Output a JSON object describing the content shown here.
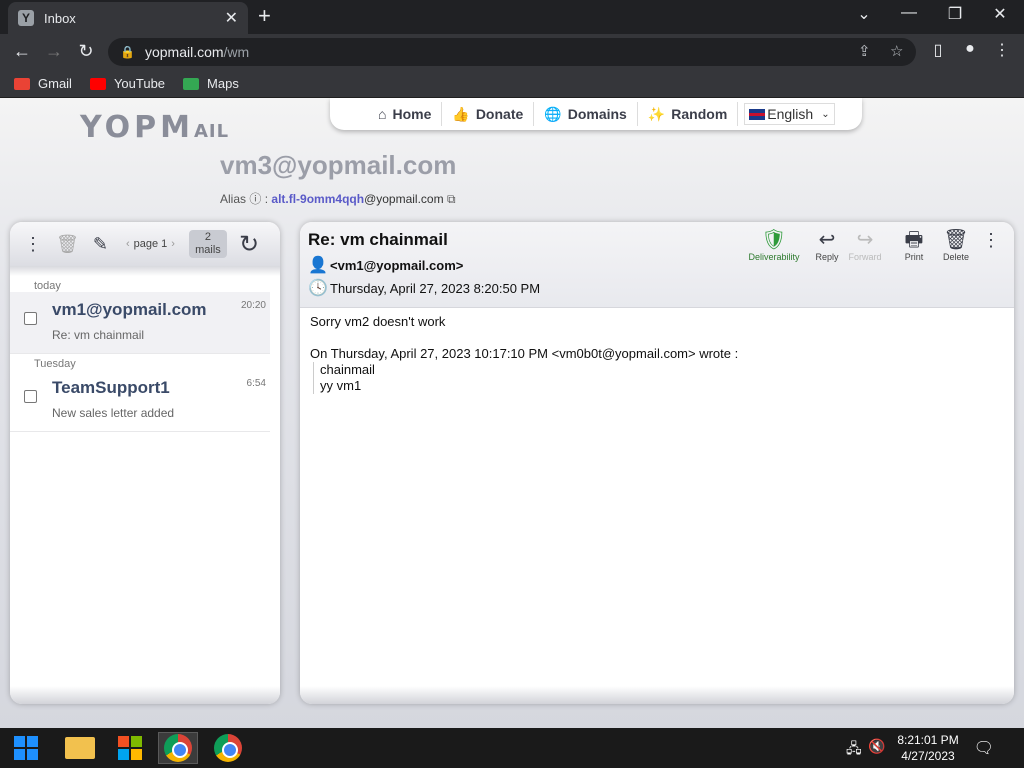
{
  "browser": {
    "tab_title": "Inbox",
    "tab_favicon": "Y",
    "url_host": "yopmail.com",
    "url_path": "/wm",
    "bookmarks": [
      {
        "label": "Gmail",
        "color": "#ea4335"
      },
      {
        "label": "YouTube",
        "color": "#ff0000"
      },
      {
        "label": "Maps",
        "color": "#34a853"
      }
    ]
  },
  "site": {
    "logo_main": "YOPM",
    "logo_tail": "AIL",
    "nav": [
      {
        "label": "Home",
        "icon": "home-icon",
        "glyph": "⌂"
      },
      {
        "label": "Donate",
        "icon": "thumbs-up-icon",
        "glyph": "👍"
      },
      {
        "label": "Domains",
        "icon": "globe-icon",
        "glyph": "🌐"
      },
      {
        "label": "Random",
        "icon": "magic-wand-icon",
        "glyph": "✨"
      }
    ],
    "language": "English",
    "mailbox": "vm3@yopmail.com",
    "alias_label": "Alias",
    "alias_value": "alt.fl-9omm4qqh",
    "alias_domain": "@yopmail.com"
  },
  "inbox": {
    "page_label": "page 1",
    "mail_count": "2",
    "mail_count_label": "mails",
    "groups": [
      {
        "day": "today",
        "from": "vm1@yopmail.com",
        "subject": "Re: vm chainmail",
        "time": "20:20"
      },
      {
        "day": "Tuesday",
        "from": "TeamSupport1",
        "subject": "New sales letter added",
        "time": "6:54"
      }
    ]
  },
  "message": {
    "subject": "Re: vm chainmail",
    "from": "<vm1@yopmail.com>",
    "date": "Thursday, April 27, 2023 8:20:50 PM",
    "actions": {
      "deliverability": "Deliverability",
      "reply": "Reply",
      "forward": "Forward",
      "print": "Print",
      "delete": "Delete"
    },
    "body_line1": "Sorry vm2 doesn't work",
    "quote_header": "On Thursday, April 27, 2023 10:17:10 PM <vm0b0t@yopmail.com> wrote :",
    "quote_line1": "chainmail",
    "quote_line2": "yy vm1"
  },
  "taskbar": {
    "time": "8:21:01 PM",
    "date": "4/27/2023"
  }
}
